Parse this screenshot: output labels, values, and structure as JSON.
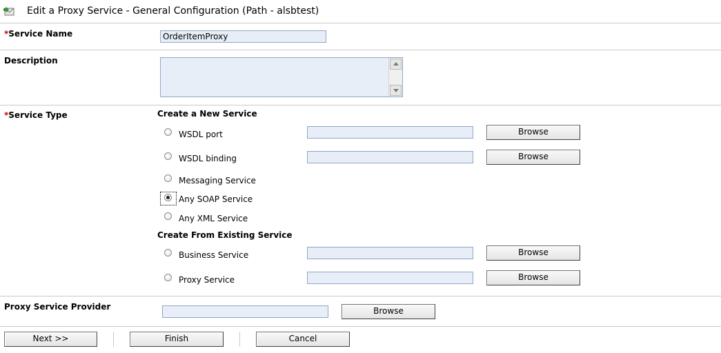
{
  "header": {
    "title": "Edit a Proxy Service - General Configuration (Path - alsbtest)",
    "icon": "proxy-service-icon"
  },
  "service_name": {
    "label": "Service Name",
    "required_marker": "*",
    "value": "OrderItemProxy"
  },
  "description": {
    "label": "Description",
    "value": ""
  },
  "service_type": {
    "label": "Service Type",
    "required_marker": "*",
    "create_new_heading": "Create a New Service",
    "create_existing_heading": "Create From Existing Service",
    "options": [
      {
        "label": "WSDL port",
        "value": "",
        "browse": "Browse",
        "selected": false
      },
      {
        "label": "WSDL binding",
        "value": "",
        "browse": "Browse",
        "selected": false
      },
      {
        "label": "Messaging Service",
        "selected": false
      },
      {
        "label": "Any SOAP Service",
        "selected": true
      },
      {
        "label": "Any XML Service",
        "selected": false
      },
      {
        "label": "Business Service",
        "value": "",
        "browse": "Browse",
        "selected": false
      },
      {
        "label": "Proxy Service",
        "value": "",
        "browse": "Browse",
        "selected": false
      }
    ]
  },
  "provider": {
    "label": "Proxy Service Provider",
    "value": "",
    "browse": "Browse"
  },
  "footer": {
    "next": "Next >>",
    "finish": "Finish",
    "cancel": "Cancel"
  }
}
